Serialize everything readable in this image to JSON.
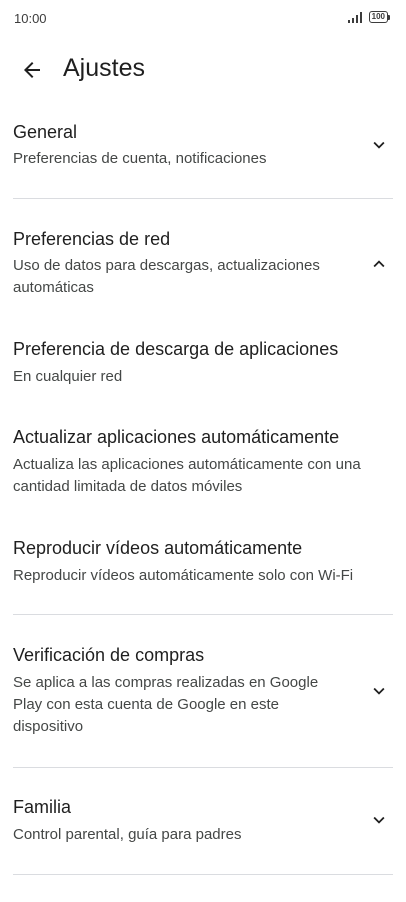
{
  "status_bar": {
    "time": "10:00",
    "battery": "100"
  },
  "header": {
    "title": "Ajustes",
    "back_icon": "arrow-back-icon"
  },
  "sections": {
    "general": {
      "title": "General",
      "subtitle": "Preferencias de cuenta, notificaciones",
      "expanded": false
    },
    "network": {
      "title": "Preferencias de red",
      "subtitle_lines": [
        "Uso de datos para descargas, actualizaciones",
        "automáticas"
      ],
      "expanded": true,
      "items": {
        "download": {
          "title": "Preferencia de descarga de aplicaciones",
          "subtitle": "En cualquier red"
        },
        "autoupdate": {
          "title": "Actualizar aplicaciones automáticamente",
          "subtitle_lines": [
            "Actualiza las aplicaciones automáticamente con una",
            "cantidad limitada de datos móviles"
          ]
        },
        "autoplay": {
          "title": "Reproducir vídeos automáticamente",
          "subtitle": "Reproducir vídeos automáticamente solo con Wi-Fi"
        }
      }
    },
    "purchase": {
      "title": "Verificación de compras",
      "subtitle_lines": [
        "Se aplica a las compras realizadas en Google",
        "Play con esta cuenta de Google en este",
        "dispositivo"
      ],
      "expanded": false
    },
    "family": {
      "title": "Familia",
      "subtitle": "Control parental, guía para padres",
      "expanded": false
    }
  },
  "colors": {
    "text_primary": "#1f1f1f",
    "text_secondary": "#444746",
    "divider": "#dadce0"
  }
}
